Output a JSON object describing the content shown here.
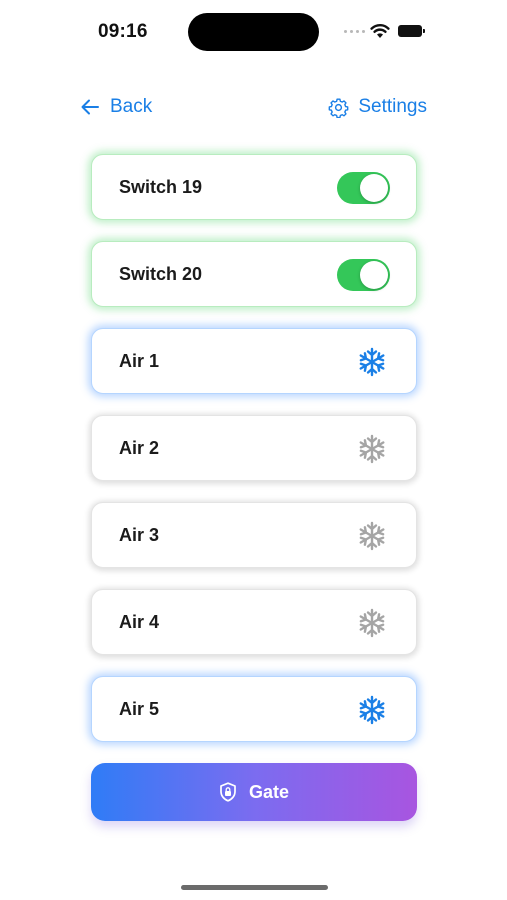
{
  "status_bar": {
    "time": "09:16"
  },
  "nav": {
    "back_label": "Back",
    "settings_label": "Settings"
  },
  "items": [
    {
      "label": "Switch 19",
      "kind": "switch",
      "on": true
    },
    {
      "label": "Switch 20",
      "kind": "switch",
      "on": true
    },
    {
      "label": "Air 1",
      "kind": "air",
      "on": true
    },
    {
      "label": "Air 2",
      "kind": "air",
      "on": false
    },
    {
      "label": "Air 3",
      "kind": "air",
      "on": false
    },
    {
      "label": "Air 4",
      "kind": "air",
      "on": false
    },
    {
      "label": "Air 5",
      "kind": "air",
      "on": true
    }
  ],
  "gate_button": {
    "label": "Gate"
  },
  "colors": {
    "accent": "#1a7fe6",
    "switch_on": "#34c759",
    "air_on": "#1a7fe6",
    "air_off": "#a5a5a5",
    "gate_gradient_start": "#2f7cf6",
    "gate_gradient_end": "#a855e0"
  },
  "icons": {
    "back": "arrow-left-icon",
    "settings": "gear-icon",
    "air": "snowflake-icon",
    "gate": "shield-lock-icon"
  }
}
